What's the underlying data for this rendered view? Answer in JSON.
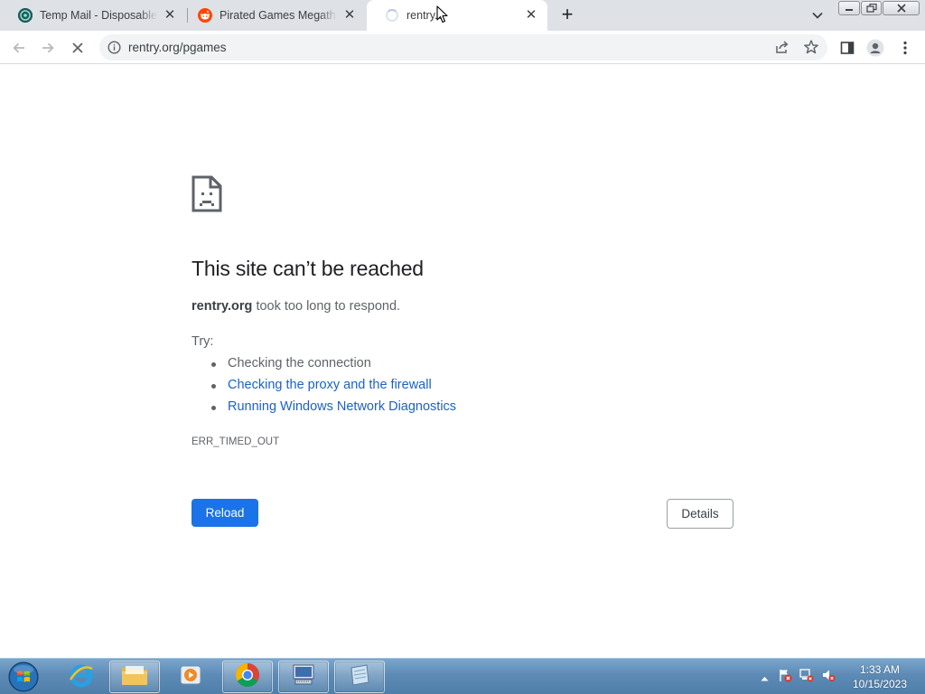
{
  "browser": {
    "tabs": [
      {
        "title": "Temp Mail - Disposable Te",
        "favicon": "tempmail-icon",
        "active": false
      },
      {
        "title": "Pirated Games Megathre",
        "favicon": "reddit-icon",
        "active": false
      },
      {
        "title": "rentry.o",
        "favicon": "loading-spinner",
        "active": true
      }
    ],
    "address": "rentry.org/pgames"
  },
  "error_page": {
    "title": "This site can’t be reached",
    "host": "rentry.org",
    "description_rest": " took too long to respond.",
    "try_label": "Try:",
    "suggestions": [
      {
        "text": "Checking the connection",
        "link": false
      },
      {
        "text": "Checking the proxy and the firewall",
        "link": true
      },
      {
        "text": "Running Windows Network Diagnostics",
        "link": true
      }
    ],
    "error_code": "ERR_TIMED_OUT",
    "reload_label": "Reload",
    "details_label": "Details"
  },
  "taskbar": {
    "apps": [
      "internet-explorer",
      "file-explorer",
      "media-player",
      "chrome",
      "network-app",
      "notepad-app"
    ],
    "clock_time": "1:33 AM",
    "clock_date": "10/15/2023"
  },
  "colors": {
    "accent_blue": "#1a73e8",
    "link_blue": "#1a62c7",
    "tabstrip_bg": "#dee1e6"
  }
}
